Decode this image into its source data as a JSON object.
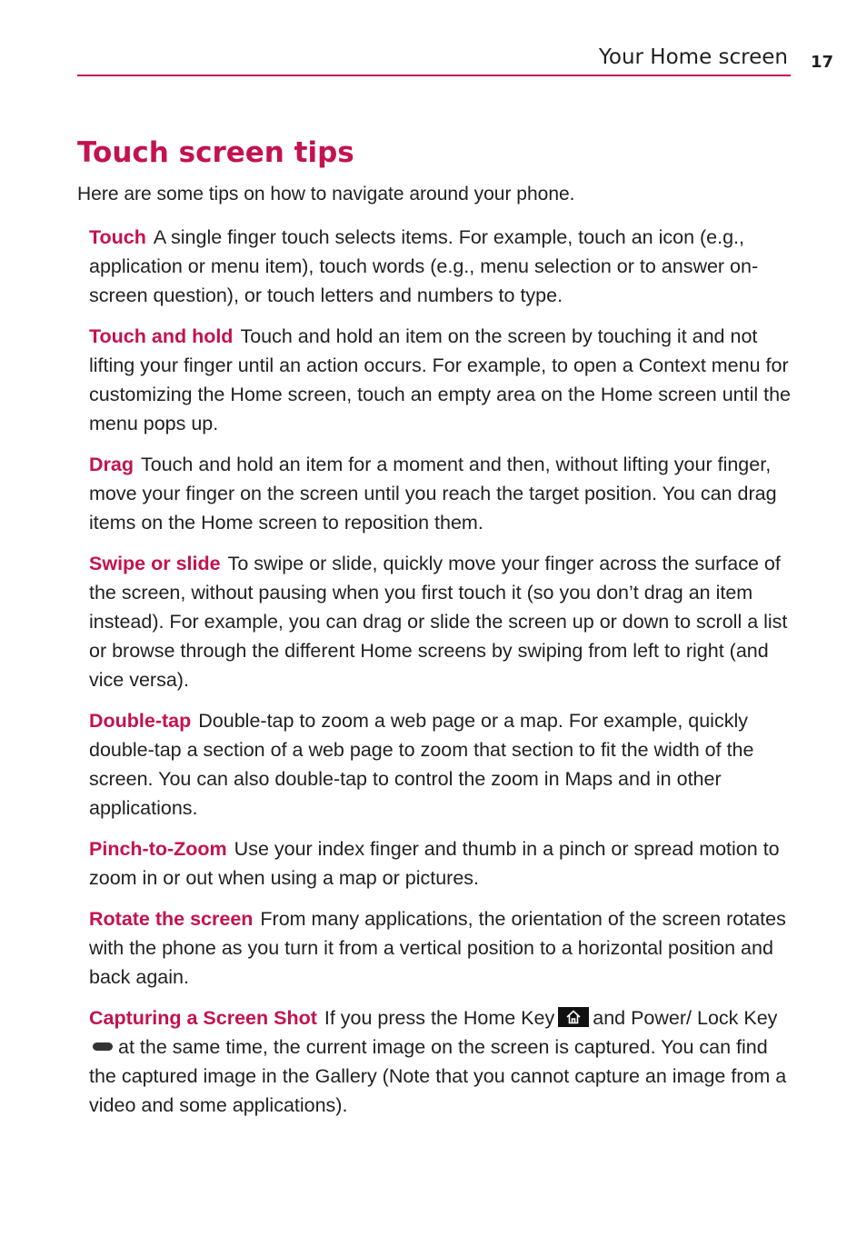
{
  "header": {
    "section_title": "Your Home screen",
    "page_number": "17",
    "accent_color": "#c4124f"
  },
  "title": "Touch screen tips",
  "intro": "Here are some tips on how to navigate around your phone.",
  "tips": [
    {
      "term": "Touch",
      "text": "A single finger touch selects items. For example, touch an icon (e.g., application or menu item), touch words (e.g., menu selection or to answer on-screen question), or touch letters and numbers to type."
    },
    {
      "term": "Touch and hold",
      "text": "Touch and hold an item on the screen by touching it and not lifting your finger until an action occurs. For example, to open a Context menu for customizing the Home screen, touch an empty area on the Home screen until the menu pops up."
    },
    {
      "term": "Drag",
      "text": "Touch and hold an item for a moment and then, without lifting your finger, move your finger on the screen until you reach the target position. You can drag items on the Home screen to reposition them."
    },
    {
      "term": "Swipe or slide",
      "text": "To swipe or slide, quickly move your finger across the surface of the screen, without pausing when you first touch it (so you don’t drag an item instead). For example, you can drag or slide the screen up or down to scroll a list or browse through the different Home screens by swiping from left to right (and vice versa)."
    },
    {
      "term": "Double-tap",
      "text": "Double-tap to zoom a web page or a map. For example, quickly double-tap a section of a web page to zoom that section to fit the width of the screen. You can also double-tap to control the zoom in Maps and in other applications."
    },
    {
      "term": "Pinch-to-Zoom",
      "text": "Use your index finger and thumb in a pinch or spread motion to zoom in or out when using a map or pictures."
    },
    {
      "term": "Rotate the screen",
      "text": "From many applications, the orientation of the screen rotates with the phone as you turn it from a vertical position to a horizontal position and back again."
    }
  ],
  "capture": {
    "term": "Capturing a Screen Shot",
    "text_1": "If you press the",
    "home_key": "Home Key",
    "home_icon": "home-icon",
    "text_2": "and",
    "power_key": "Power/ Lock Key",
    "power_icon": "power-lock-key-icon",
    "text_3": "at the same time, the current image on the screen is captured. You can find the captured image in the Gallery (Note that you cannot capture an image from a video and some applications)."
  }
}
